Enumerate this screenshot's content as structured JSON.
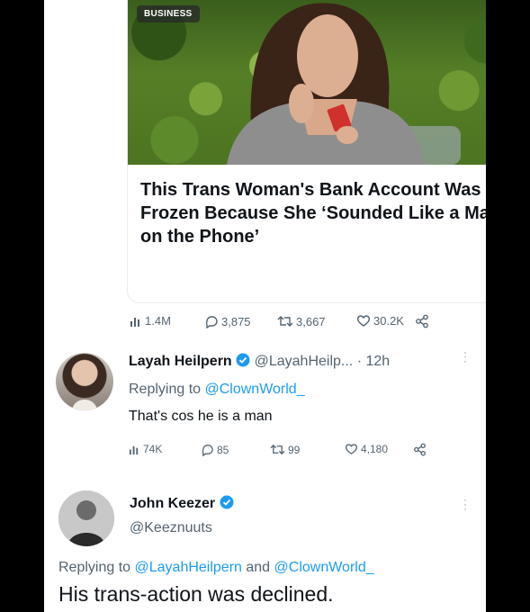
{
  "article": {
    "badge": "BUSINESS",
    "headline": "This Trans Woman's Bank Account Was Frozen Because She ‘Sounded Like a Man on the Phone’"
  },
  "tweet1_stats": {
    "views": "1.4M",
    "replies": "3,875",
    "retweets": "3,667",
    "likes": "30.2K"
  },
  "reply1": {
    "name": "Layah Heilpern",
    "handle": "@LayahHeilp...",
    "time": "· 12h",
    "replying_label": "Replying to",
    "replying_to": "@ClownWorld_",
    "text": "That's cos he is a man",
    "stats": {
      "views": "74K",
      "replies": "85",
      "retweets": "99",
      "likes": "4,180"
    }
  },
  "reply2": {
    "name": "John Keezer",
    "handle": "@Keeznuuts",
    "replying_label": "Replying to",
    "replying_to_1": "@LayahHeilpern",
    "and": "and",
    "replying_to_2": "@ClownWorld_",
    "text": "His trans-action was declined."
  },
  "colors": {
    "accent": "#1d9bf0",
    "muted": "#536471",
    "text": "#0f1419"
  }
}
